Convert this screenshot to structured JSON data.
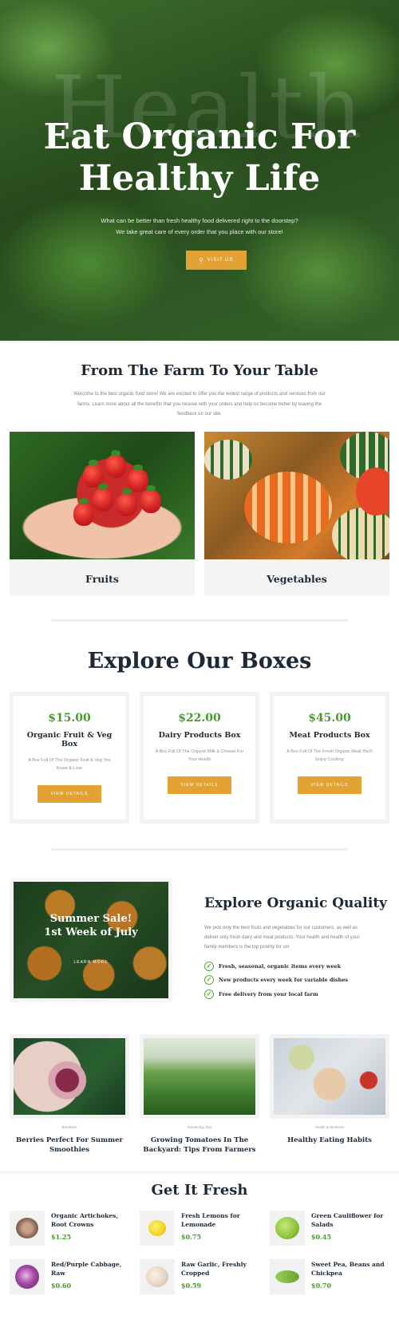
{
  "hero": {
    "ghost_text": "Health",
    "title_line1": "Eat Organic For",
    "title_line2": "Healthy Life",
    "subtitle_line1": "What can be better than fresh healthy food delivered right to the doorstep?",
    "subtitle_line2": "We take great care of every order that you place with our store!",
    "button_label": "VISIT US"
  },
  "farm": {
    "title": "From The Farm To Your Table",
    "text": "Welcome to the best organic food store! We are excited to offer you the widest range of products and services from our farms. Learn more about all the benefits that you receive with your orders and help us become better by leaving the feedback on our site.",
    "categories": [
      {
        "label": "Fruits"
      },
      {
        "label": "Vegetables"
      }
    ]
  },
  "boxes": {
    "title": "Explore Our Boxes",
    "items": [
      {
        "price": "$15.00",
        "name": "Organic Fruit & Veg Box",
        "desc": "A Box Full Of The Organic Fruit & Veg You Know & Love",
        "button": "VIEW DETAILS"
      },
      {
        "price": "$22.00",
        "name": "Dairy Products Box",
        "desc": "A Box Full Of The Organic Milk & Cheese For Your Health",
        "button": "VIEW DETAILS"
      },
      {
        "price": "$45.00",
        "name": "Meat Products Box",
        "desc": "A Box Full Of The Fresh Organic Meat You'll Enjoy Cooking",
        "button": "VIEW DETAILS"
      }
    ]
  },
  "promo": {
    "title_line1": "Summer Sale!",
    "title_line2": "1st Week of July",
    "link": "LEARN MORE"
  },
  "quality": {
    "title": "Explore Organic Quality",
    "text": "We pick only the best fruits and vegetables for our customers, as well as deliver only fresh dairy and meat products. Your health and health of your family members is the top priority for us!",
    "checks": [
      "Fresh, seasonal, organic items every week",
      "New products every week for variable dishes",
      "Free delivery from your local farm"
    ]
  },
  "blog": [
    {
      "category": "Breakfast",
      "title": "Berries Perfect For Summer Smoothies"
    },
    {
      "category": "Gardening Tips",
      "title": "Growing Tomatoes In The Backyard: Tips From Farmers"
    },
    {
      "category": "Health & Wellness",
      "title": "Healthy Eating Habits"
    }
  ],
  "fresh": {
    "title": "Get It Fresh",
    "products": [
      {
        "name": "Organic Artichokes, Root Crowns",
        "price": "$1.25",
        "icon": "artichoke-icon"
      },
      {
        "name": "Fresh Lemons for Lemonade",
        "price": "$0.75",
        "icon": "lemon-icon"
      },
      {
        "name": "Green Cauliflower for Salads",
        "price": "$0.45",
        "icon": "cauliflower-icon"
      },
      {
        "name": "Red/Purple Cabbage, Raw",
        "price": "$0.60",
        "icon": "cabbage-icon"
      },
      {
        "name": "Raw Garlic, Freshly Cropped",
        "price": "$0.59",
        "icon": "garlic-icon"
      },
      {
        "name": "Sweet Pea, Beans and Chickpea",
        "price": "$0.70",
        "icon": "pea-icon"
      }
    ]
  },
  "colors": {
    "accent": "#e3a234",
    "price_green": "#4a9a2e",
    "heading": "#1d2a36"
  }
}
